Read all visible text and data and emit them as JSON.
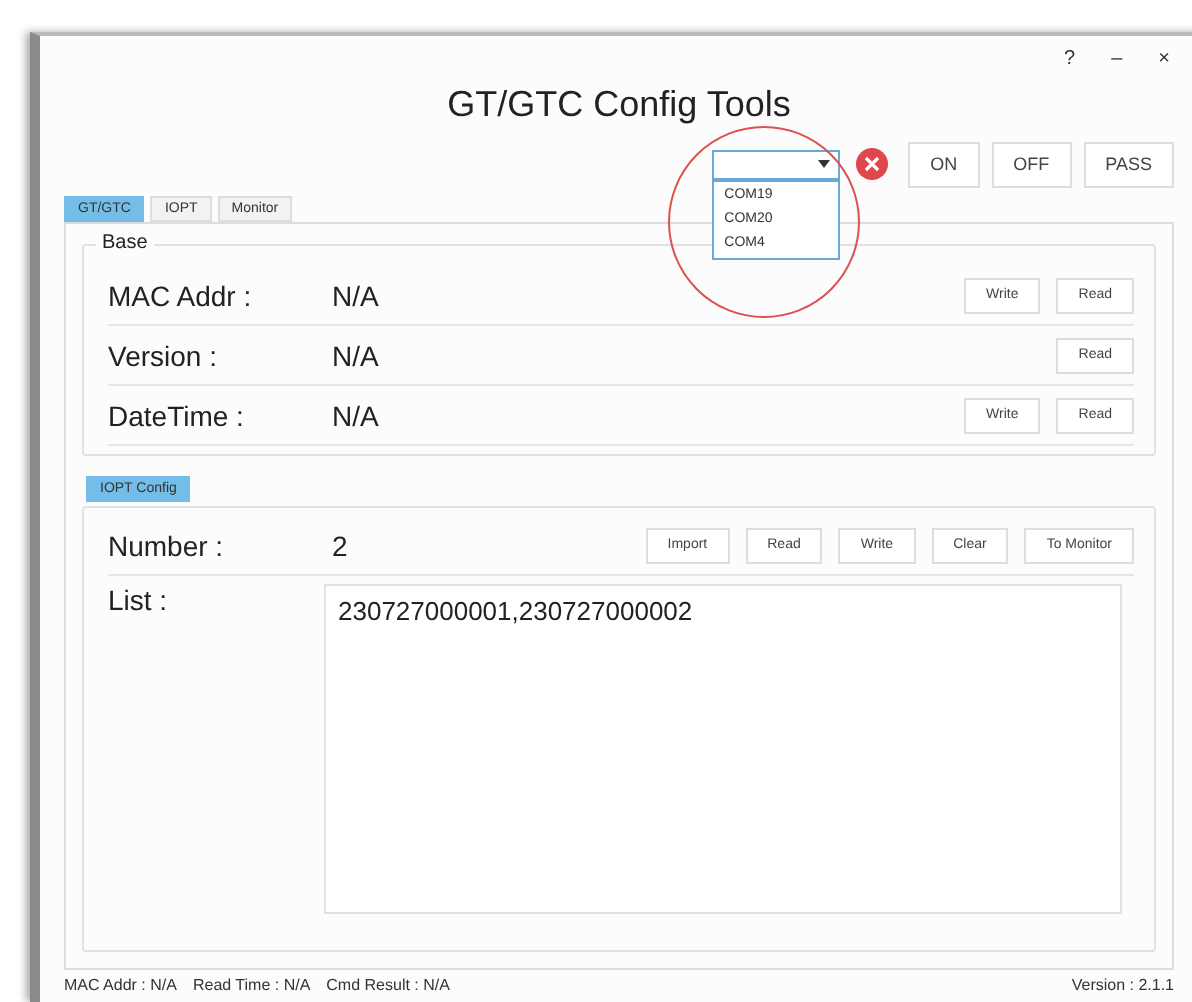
{
  "window": {
    "title": "GT/GTC Config Tools",
    "controls": [
      "?",
      "–",
      "×"
    ]
  },
  "toolbar": {
    "port_combo": {
      "expanded": true,
      "options": [
        "COM19",
        "COM20",
        "COM4"
      ]
    },
    "buttons": [
      "ON",
      "OFF",
      "PASS"
    ]
  },
  "tabs": [
    {
      "label": "GT/GTC",
      "selected": true
    },
    {
      "label": "IOPT",
      "selected": false
    },
    {
      "label": "Monitor",
      "selected": false
    }
  ],
  "base": {
    "title": "Base",
    "rows": [
      {
        "label": "MAC Addr :",
        "value": "N/A",
        "buttons": [
          "Write",
          "Read"
        ]
      },
      {
        "label": "Version :",
        "value": "N/A",
        "buttons": [
          "Read"
        ]
      },
      {
        "label": "DateTime :",
        "value": "N/A",
        "buttons": [
          "Write",
          "Read"
        ]
      }
    ]
  },
  "iopt_config": {
    "tab": {
      "label": "IOPT Config",
      "selected": true
    },
    "number_label": "Number :",
    "number_value": "2",
    "buttons": [
      "Import",
      "Read",
      "Write",
      "Clear",
      "To Monitor"
    ],
    "list_label": "List :",
    "list_value": "230727000001,230727000002"
  },
  "status_bar": {
    "left": [
      "MAC Addr : N/A",
      "Read Time : N/A",
      "Cmd Result : N/A"
    ],
    "right": "Version : 2.1.1"
  }
}
